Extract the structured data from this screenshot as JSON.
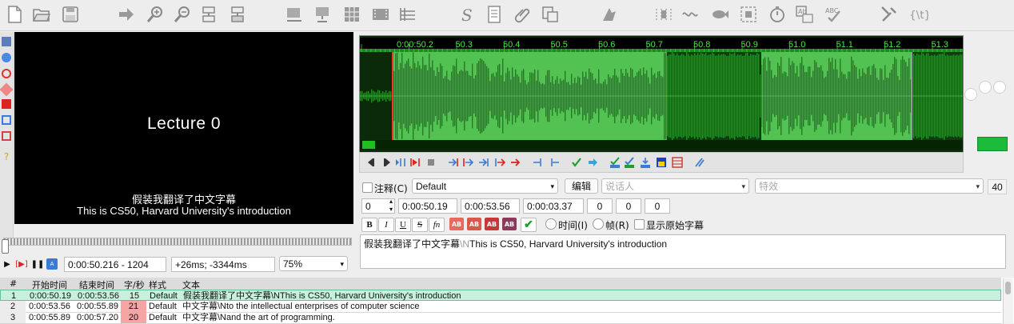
{
  "toolbar": {
    "icons": [
      "new-file-icon",
      "open-folder-icon",
      "save-icon",
      "arrow-right-icon",
      "zoom-in-icon",
      "zoom-out-icon",
      "find-icon",
      "replace-icon",
      "styles-icon",
      "attachments-icon",
      "properties-icon",
      "video-icon",
      "grid-icon",
      "s-icon",
      "document-icon",
      "paperclip-icon",
      "fonts-icon",
      "resample-icon",
      "spell-icon",
      "shift-times-icon",
      "fish-icon",
      "select-icon",
      "timer-icon",
      "translate-icon",
      "check-icon",
      "tools-icon",
      "automation-icon"
    ]
  },
  "video": {
    "title": "Lecture 0",
    "subtitle_line1": "假装我翻译了中文字幕",
    "subtitle_line2": "This is CS50, Harvard University's introduction"
  },
  "video_controls": {
    "time_frame": "0:00:50.216 - 1204",
    "offset": "+26ms; -3344ms",
    "zoom": "75%"
  },
  "audio": {
    "timeline_labels": [
      "0:00:50.2",
      "50.3",
      "50.4",
      "50.5",
      "50.6",
      "50.7",
      "50.8",
      "50.9",
      "51.0",
      "51.1",
      "51.2",
      "51.3"
    ],
    "colors": {
      "waveform": "#2f9a2f",
      "selection": "#52c252",
      "background": "#0a2a0a",
      "marker": "#ff3030"
    }
  },
  "edit": {
    "comment_label": "注释(C)",
    "style": "Default",
    "edit_button": "编辑",
    "actor_placeholder": "说话人",
    "effect_placeholder": "特效",
    "margin_count": "40",
    "layer": "0",
    "start_time": "0:00:50.19",
    "end_time": "0:00:53.56",
    "duration": "0:00:03.37",
    "margin_l": "0",
    "margin_r": "0",
    "margin_v": "0",
    "fmt_bold": "B",
    "fmt_italic": "I",
    "fmt_underline": "U",
    "fmt_strike": "S",
    "fmt_fn": "fn",
    "ab": "AB",
    "time_radio": "时间(I)",
    "frame_radio": "帧(R)",
    "show_original": "显示原始字幕",
    "text_part1": "假装我翻译了中文字幕",
    "text_tag": "\\N",
    "text_part2": "This is CS50, Harvard University's introduction"
  },
  "grid": {
    "headers": {
      "num": "#",
      "start": "开始时间",
      "end": "结束时间",
      "cps": "字/秒",
      "style": "样式",
      "text": "文本"
    },
    "rows": [
      {
        "num": "1",
        "start": "0:00:50.19",
        "end": "0:00:53.56",
        "cps": "15",
        "style": "Default",
        "text": "假装我翻译了中文字幕\\NThis is CS50, Harvard University's introduction"
      },
      {
        "num": "2",
        "start": "0:00:53.56",
        "end": "0:00:55.89",
        "cps": "21",
        "style": "Default",
        "text": "中文字幕\\Nto the intellectual enterprises of computer science"
      },
      {
        "num": "3",
        "start": "0:00:55.89",
        "end": "0:00:57.20",
        "cps": "20",
        "style": "Default",
        "text": "中文字幕\\Nand the art of programming."
      }
    ]
  }
}
